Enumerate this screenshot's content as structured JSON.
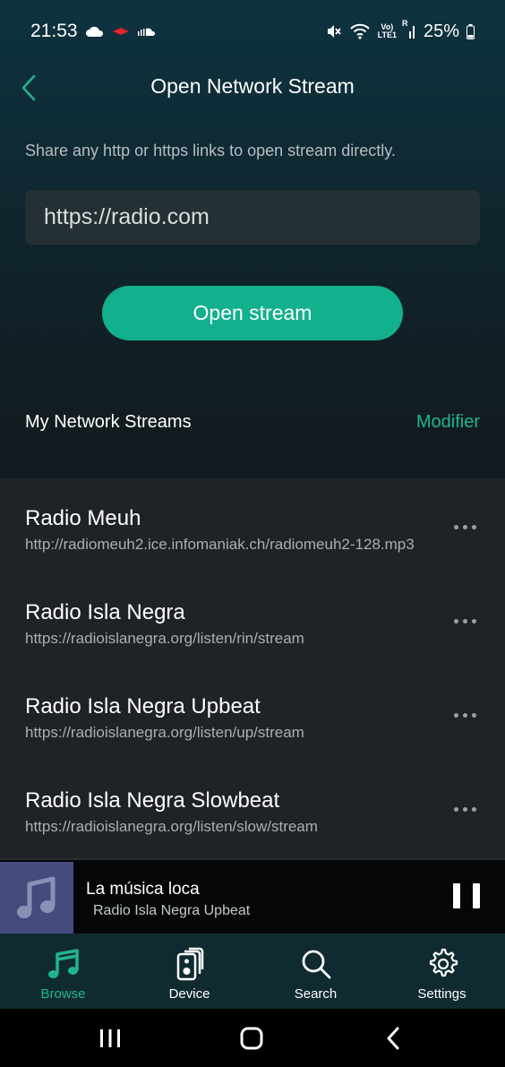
{
  "status_bar": {
    "time": "21:53",
    "icons_left": [
      "cloud-icon",
      "notification-icon",
      "soundcloud-icon"
    ],
    "icons_right": [
      "mute-icon",
      "wifi-icon",
      "volte-icon",
      "signal-icon"
    ],
    "network_label_1": "Vo)",
    "network_label_2": "LTE1",
    "roaming_label": "R",
    "battery": "25%"
  },
  "header": {
    "title": "Open Network Stream"
  },
  "share_text": "Share any http or https links to open stream directly.",
  "url_input": {
    "value": "https://radio.com"
  },
  "open_button": "Open stream",
  "streams_section": {
    "title": "My Network Streams",
    "action": "Modifier",
    "items": [
      {
        "name": "Radio Meuh",
        "url": "http://radiomeuh2.ice.infomaniak.ch/radiomeuh2-128.mp3"
      },
      {
        "name": "Radio Isla Negra",
        "url": "https://radioislanegra.org/listen/rin/stream"
      },
      {
        "name": "Radio Isla Negra Upbeat",
        "url": "https://radioislanegra.org/listen/up/stream"
      },
      {
        "name": "Radio Isla Negra Slowbeat",
        "url": "https://radioislanegra.org/listen/slow/stream"
      }
    ]
  },
  "player": {
    "track_title": "La música loca",
    "station": "Radio Isla Negra Upbeat",
    "state": "playing"
  },
  "bottom_nav": {
    "items": [
      {
        "label": "Browse",
        "icon": "music-note-icon",
        "active": true
      },
      {
        "label": "Device",
        "icon": "speaker-icon",
        "active": false
      },
      {
        "label": "Search",
        "icon": "search-icon",
        "active": false
      },
      {
        "label": "Settings",
        "icon": "gear-icon",
        "active": false
      }
    ]
  },
  "colors": {
    "accent": "#12b08c",
    "accent_text": "#1fb48f",
    "list_background": "#1f2226",
    "nav_background": "#0f2b31"
  }
}
